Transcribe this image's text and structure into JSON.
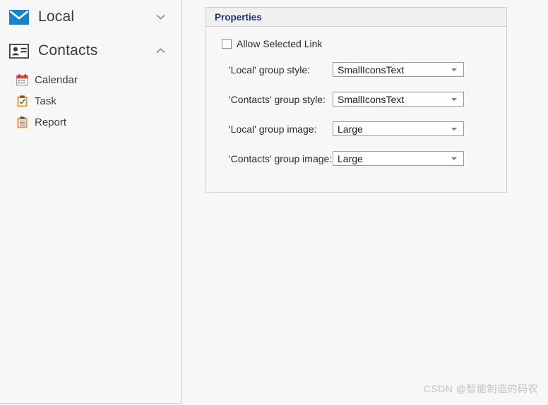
{
  "colors": {
    "page_background": "#f7f7f7",
    "panel_border": "#cfcfcf",
    "panel_header_background": "#f0f0f0",
    "panel_header_text": "#1f3864",
    "sidebar_border": "#c8c8c8",
    "envelope_blue": "#1c82c8",
    "clipboard_orange": "#f39332",
    "check_green": "#3ca03c",
    "contacts_card_dark": "#3d3d3d",
    "calendar_red": "#e8413b",
    "watermark_text": "#c2c2c2"
  },
  "sidebar": {
    "groups": [
      {
        "label": "Local",
        "icon": "envelope-icon",
        "expanded": false,
        "chevron": "chevron-down-icon",
        "children": []
      },
      {
        "label": "Contacts",
        "icon": "contact-card-icon",
        "expanded": true,
        "chevron": "chevron-up-icon",
        "children": [
          {
            "label": "Calendar",
            "icon": "calendar-icon"
          },
          {
            "label": "Task",
            "icon": "clipboard-check-icon"
          },
          {
            "label": "Report",
            "icon": "clipboard-lines-icon"
          }
        ]
      }
    ]
  },
  "properties": {
    "title": "Properties",
    "checkbox": {
      "label": "Allow Selected Link",
      "checked": false
    },
    "fields": [
      {
        "label": "'Local' group style:",
        "value": "SmallIconsText"
      },
      {
        "label": "'Contacts' group style:",
        "value": "SmallIconsText"
      },
      {
        "label": "'Local' group image:",
        "value": "Large"
      },
      {
        "label": "'Contacts' group image:",
        "value": "Large"
      }
    ]
  },
  "watermark": {
    "text": "CSDN @智能制造的码农"
  }
}
